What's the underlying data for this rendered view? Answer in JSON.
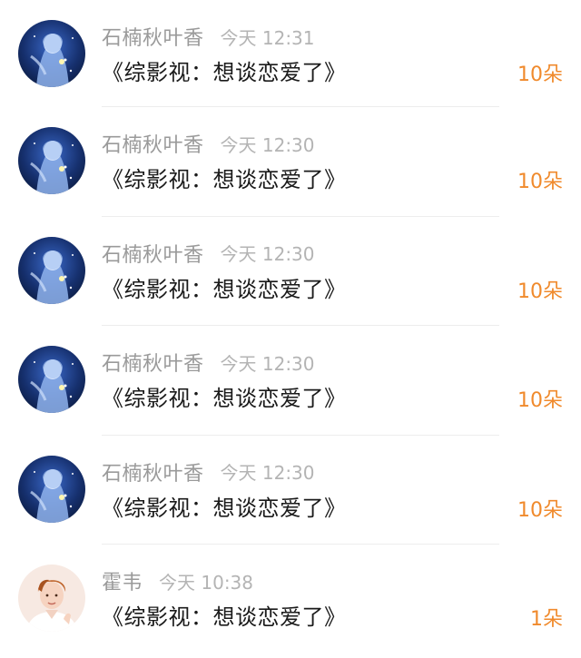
{
  "colors": {
    "name": "#9a9a9a",
    "time": "#b4b4b4",
    "title": "#1a1a1a",
    "count": "#f08a2c",
    "divider": "#ededed"
  },
  "items": [
    {
      "user": "石楠秋叶香",
      "time": "今天 12:31",
      "title": "《综影视：想谈恋爱了》",
      "count": "10朵",
      "avatar_icon": "anime-girl-avatar-icon"
    },
    {
      "user": "石楠秋叶香",
      "time": "今天 12:30",
      "title": "《综影视：想谈恋爱了》",
      "count": "10朵",
      "avatar_icon": "anime-girl-avatar-icon"
    },
    {
      "user": "石楠秋叶香",
      "time": "今天 12:30",
      "title": "《综影视：想谈恋爱了》",
      "count": "10朵",
      "avatar_icon": "anime-girl-avatar-icon"
    },
    {
      "user": "石楠秋叶香",
      "time": "今天 12:30",
      "title": "《综影视：想谈恋爱了》",
      "count": "10朵",
      "avatar_icon": "anime-girl-avatar-icon"
    },
    {
      "user": "石楠秋叶香",
      "time": "今天 12:30",
      "title": "《综影视：想谈恋爱了》",
      "count": "10朵",
      "avatar_icon": "anime-girl-avatar-icon"
    },
    {
      "user": "霍韦",
      "time": "今天 10:38",
      "title": "《综影视：想谈恋爱了》",
      "count": "1朵",
      "avatar_icon": "young-man-avatar-icon"
    }
  ]
}
